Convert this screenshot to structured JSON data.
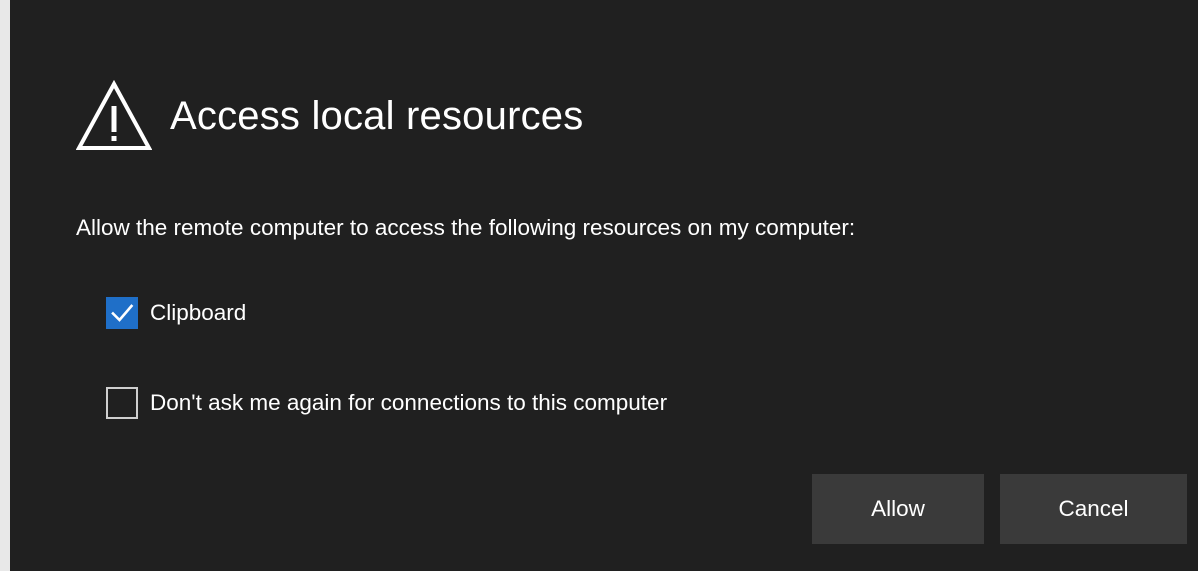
{
  "dialog": {
    "title": "Access local resources",
    "icon": "warning-triangle-icon",
    "description": "Allow the remote computer to access the following resources on my computer:",
    "options": [
      {
        "label": "Clipboard",
        "checked": true
      },
      {
        "label": "Don't ask me again for connections to this computer",
        "checked": false
      }
    ],
    "buttons": {
      "allow_label": "Allow",
      "cancel_label": "Cancel"
    },
    "colors": {
      "background": "#202020",
      "checkbox_checked": "#1f6fc8",
      "button_background": "#3a3a3a",
      "text": "#ffffff"
    }
  }
}
